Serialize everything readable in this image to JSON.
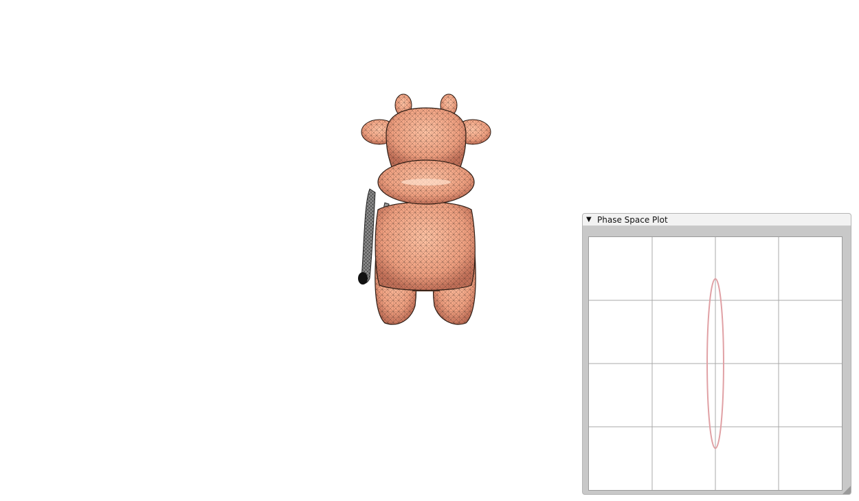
{
  "window": {
    "title": "Phase Space Plot",
    "collapse_icon": "triangle-down-icon",
    "collapse_glyph": "▼",
    "resize_icon": "resize-grip-icon"
  },
  "scene": {
    "background_color": "#ffffff",
    "mesh_color": "#f0a080",
    "mesh_line_color": "#3a2a22",
    "tail_color": "#8a8a8a"
  },
  "plot": {
    "grid_color": "#a8a8a8",
    "curve_color": "#e0a0a4",
    "grid_divisions": 4
  },
  "chart_data": {
    "type": "line",
    "title": "Phase Space Plot",
    "xlabel": "",
    "ylabel": "",
    "xlim": [
      -2,
      2
    ],
    "ylim": [
      -2,
      2
    ],
    "grid": true,
    "series": [
      {
        "shape": "ellipse",
        "center": [
          0,
          0
        ],
        "x_semi_axis": 0.13,
        "y_semi_axis": 1.34
      }
    ]
  }
}
